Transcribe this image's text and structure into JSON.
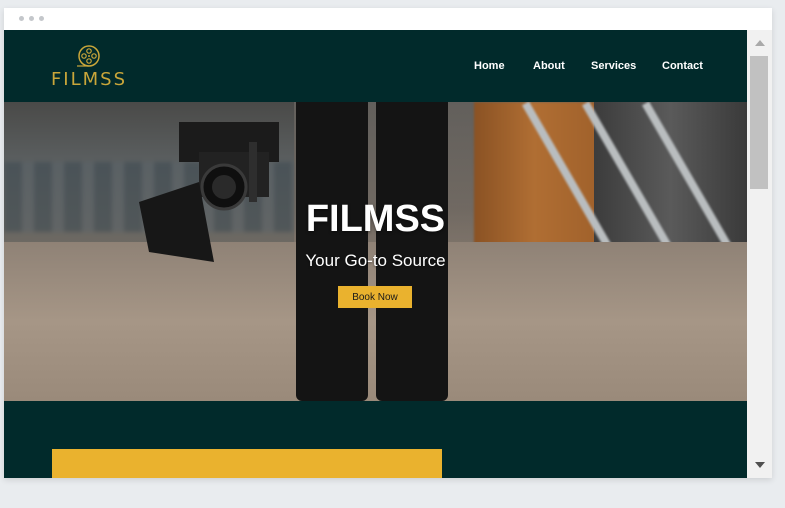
{
  "site": {
    "logo_text": "FILMSS",
    "nav": [
      {
        "label": "Home"
      },
      {
        "label": "About"
      },
      {
        "label": "Services"
      },
      {
        "label": "Contact"
      }
    ]
  },
  "hero": {
    "title": "FILMSS",
    "subtitle": "Your Go-to Source",
    "button_label": "Book Now"
  },
  "colors": {
    "dark_teal": "#012a2b",
    "gold": "#c9a63a",
    "accent_yellow": "#eab22e"
  },
  "icons": {
    "logo": "film-reel-icon",
    "scroll_up": "arrow-up-icon",
    "scroll_down": "arrow-down-icon"
  }
}
